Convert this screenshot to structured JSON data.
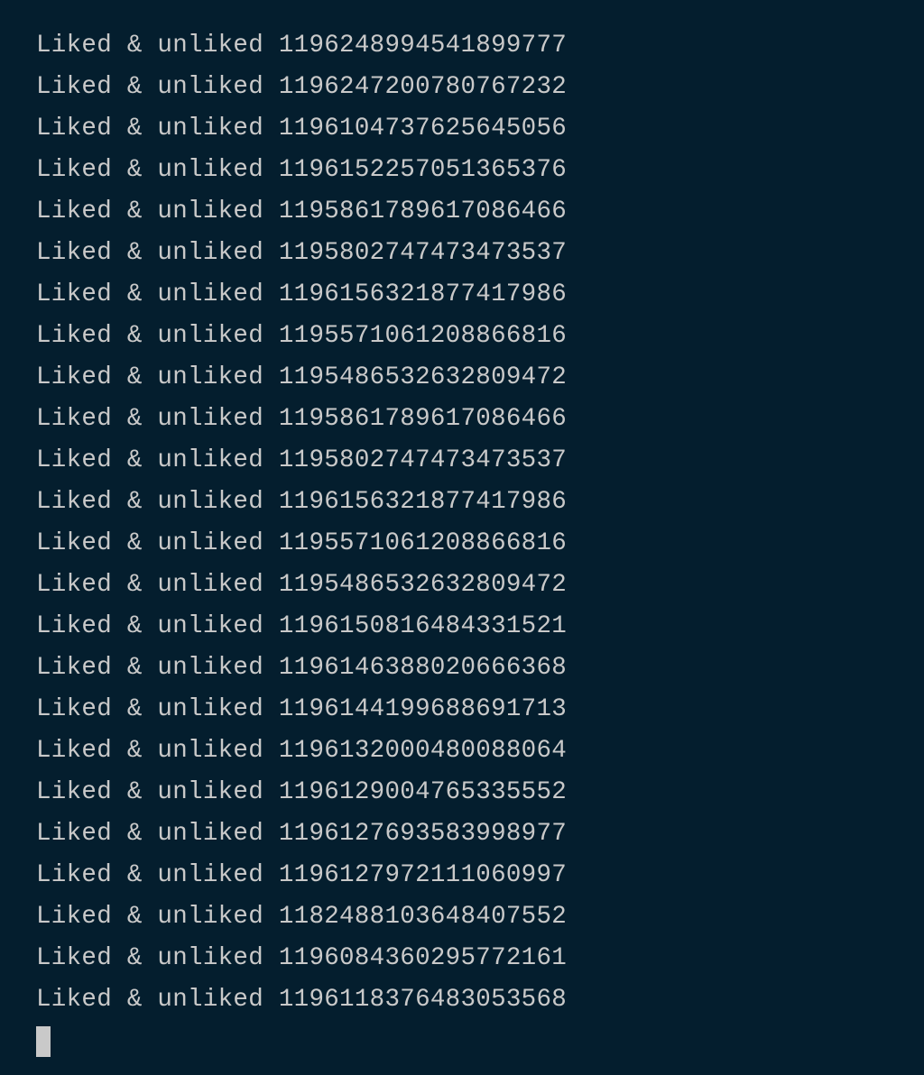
{
  "terminal": {
    "prefix": "Liked & unliked ",
    "ids": [
      "1196248994541899777",
      "1196247200780767232",
      "1196104737625645056",
      "1196152257051365376",
      "1195861789617086466",
      "1195802747473473537",
      "1196156321877417986",
      "1195571061208866816",
      "1195486532632809472",
      "1195861789617086466",
      "1195802747473473537",
      "1196156321877417986",
      "1195571061208866816",
      "1195486532632809472",
      "1196150816484331521",
      "1196146388020666368",
      "1196144199688691713",
      "1196132000480088064",
      "1196129004765335552",
      "1196127693583998977",
      "1196127972111060997",
      "1182488103648407552",
      "1196084360295772161",
      "1196118376483053568"
    ]
  }
}
